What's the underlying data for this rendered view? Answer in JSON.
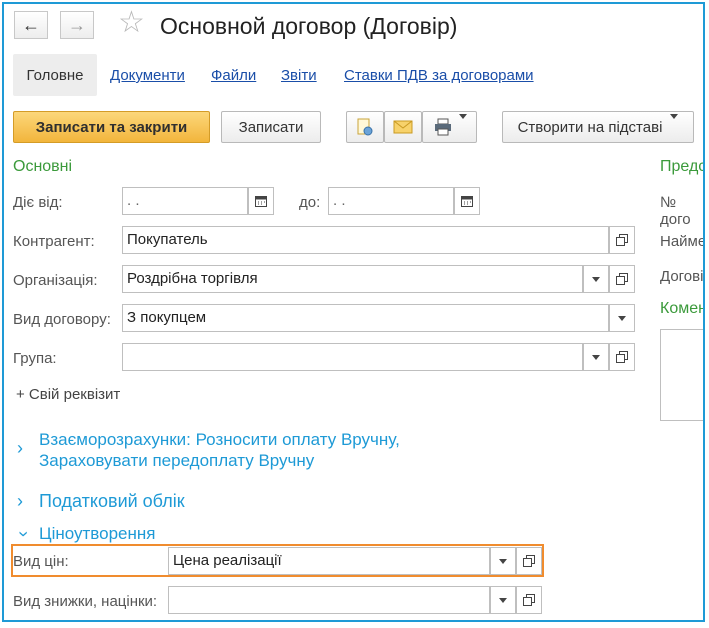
{
  "header": {
    "title": "Основной договор (Договір)",
    "back_icon": "←",
    "forward_icon": "→"
  },
  "tabs": {
    "main": "Головне",
    "links": [
      "Документи",
      "Файли",
      "Звіти",
      "Ставки ПДВ за договорами"
    ]
  },
  "toolbar": {
    "save_close": "Записати та закрити",
    "save": "Записати",
    "create_based": "Створити на підставі"
  },
  "section_main": {
    "title": "Основні",
    "valid_from_label": "Діє від:",
    "valid_from_value": " .  .",
    "valid_to_label": "до:",
    "valid_to_value": " .  .",
    "counterparty_label": "Контрагент:",
    "counterparty_value": "Покупатель",
    "organization_label": "Організація:",
    "organization_value": "Роздрібна торгівля",
    "contract_type_label": "Вид договору:",
    "contract_type_value": "З покупцем",
    "group_label": "Група:",
    "group_value": "",
    "add_attribute": "+ Свій реквізит"
  },
  "section_right": {
    "title": "Предс",
    "number_label": "№ дого",
    "name_label": "Наймен",
    "contract_label": "Догові",
    "comment_title": "Комен"
  },
  "collapsibles": {
    "settlements_line1": "Взаєморозрахунки: Розносити оплату Вручну,",
    "settlements_line2": "Зараховувати передоплату Вручну",
    "tax": "Податковий облік",
    "pricing": "Ціноутворення"
  },
  "pricing": {
    "price_type_label": "Вид цін:",
    "price_type_value": "Цена реалізації",
    "discount_label": "Вид знижки, націнки:",
    "discount_value": ""
  },
  "colors": {
    "accent": "#1e9ad6",
    "section": "#3b9a3b",
    "highlight": "#f08c2e",
    "primary_button": "#f2b53c"
  }
}
